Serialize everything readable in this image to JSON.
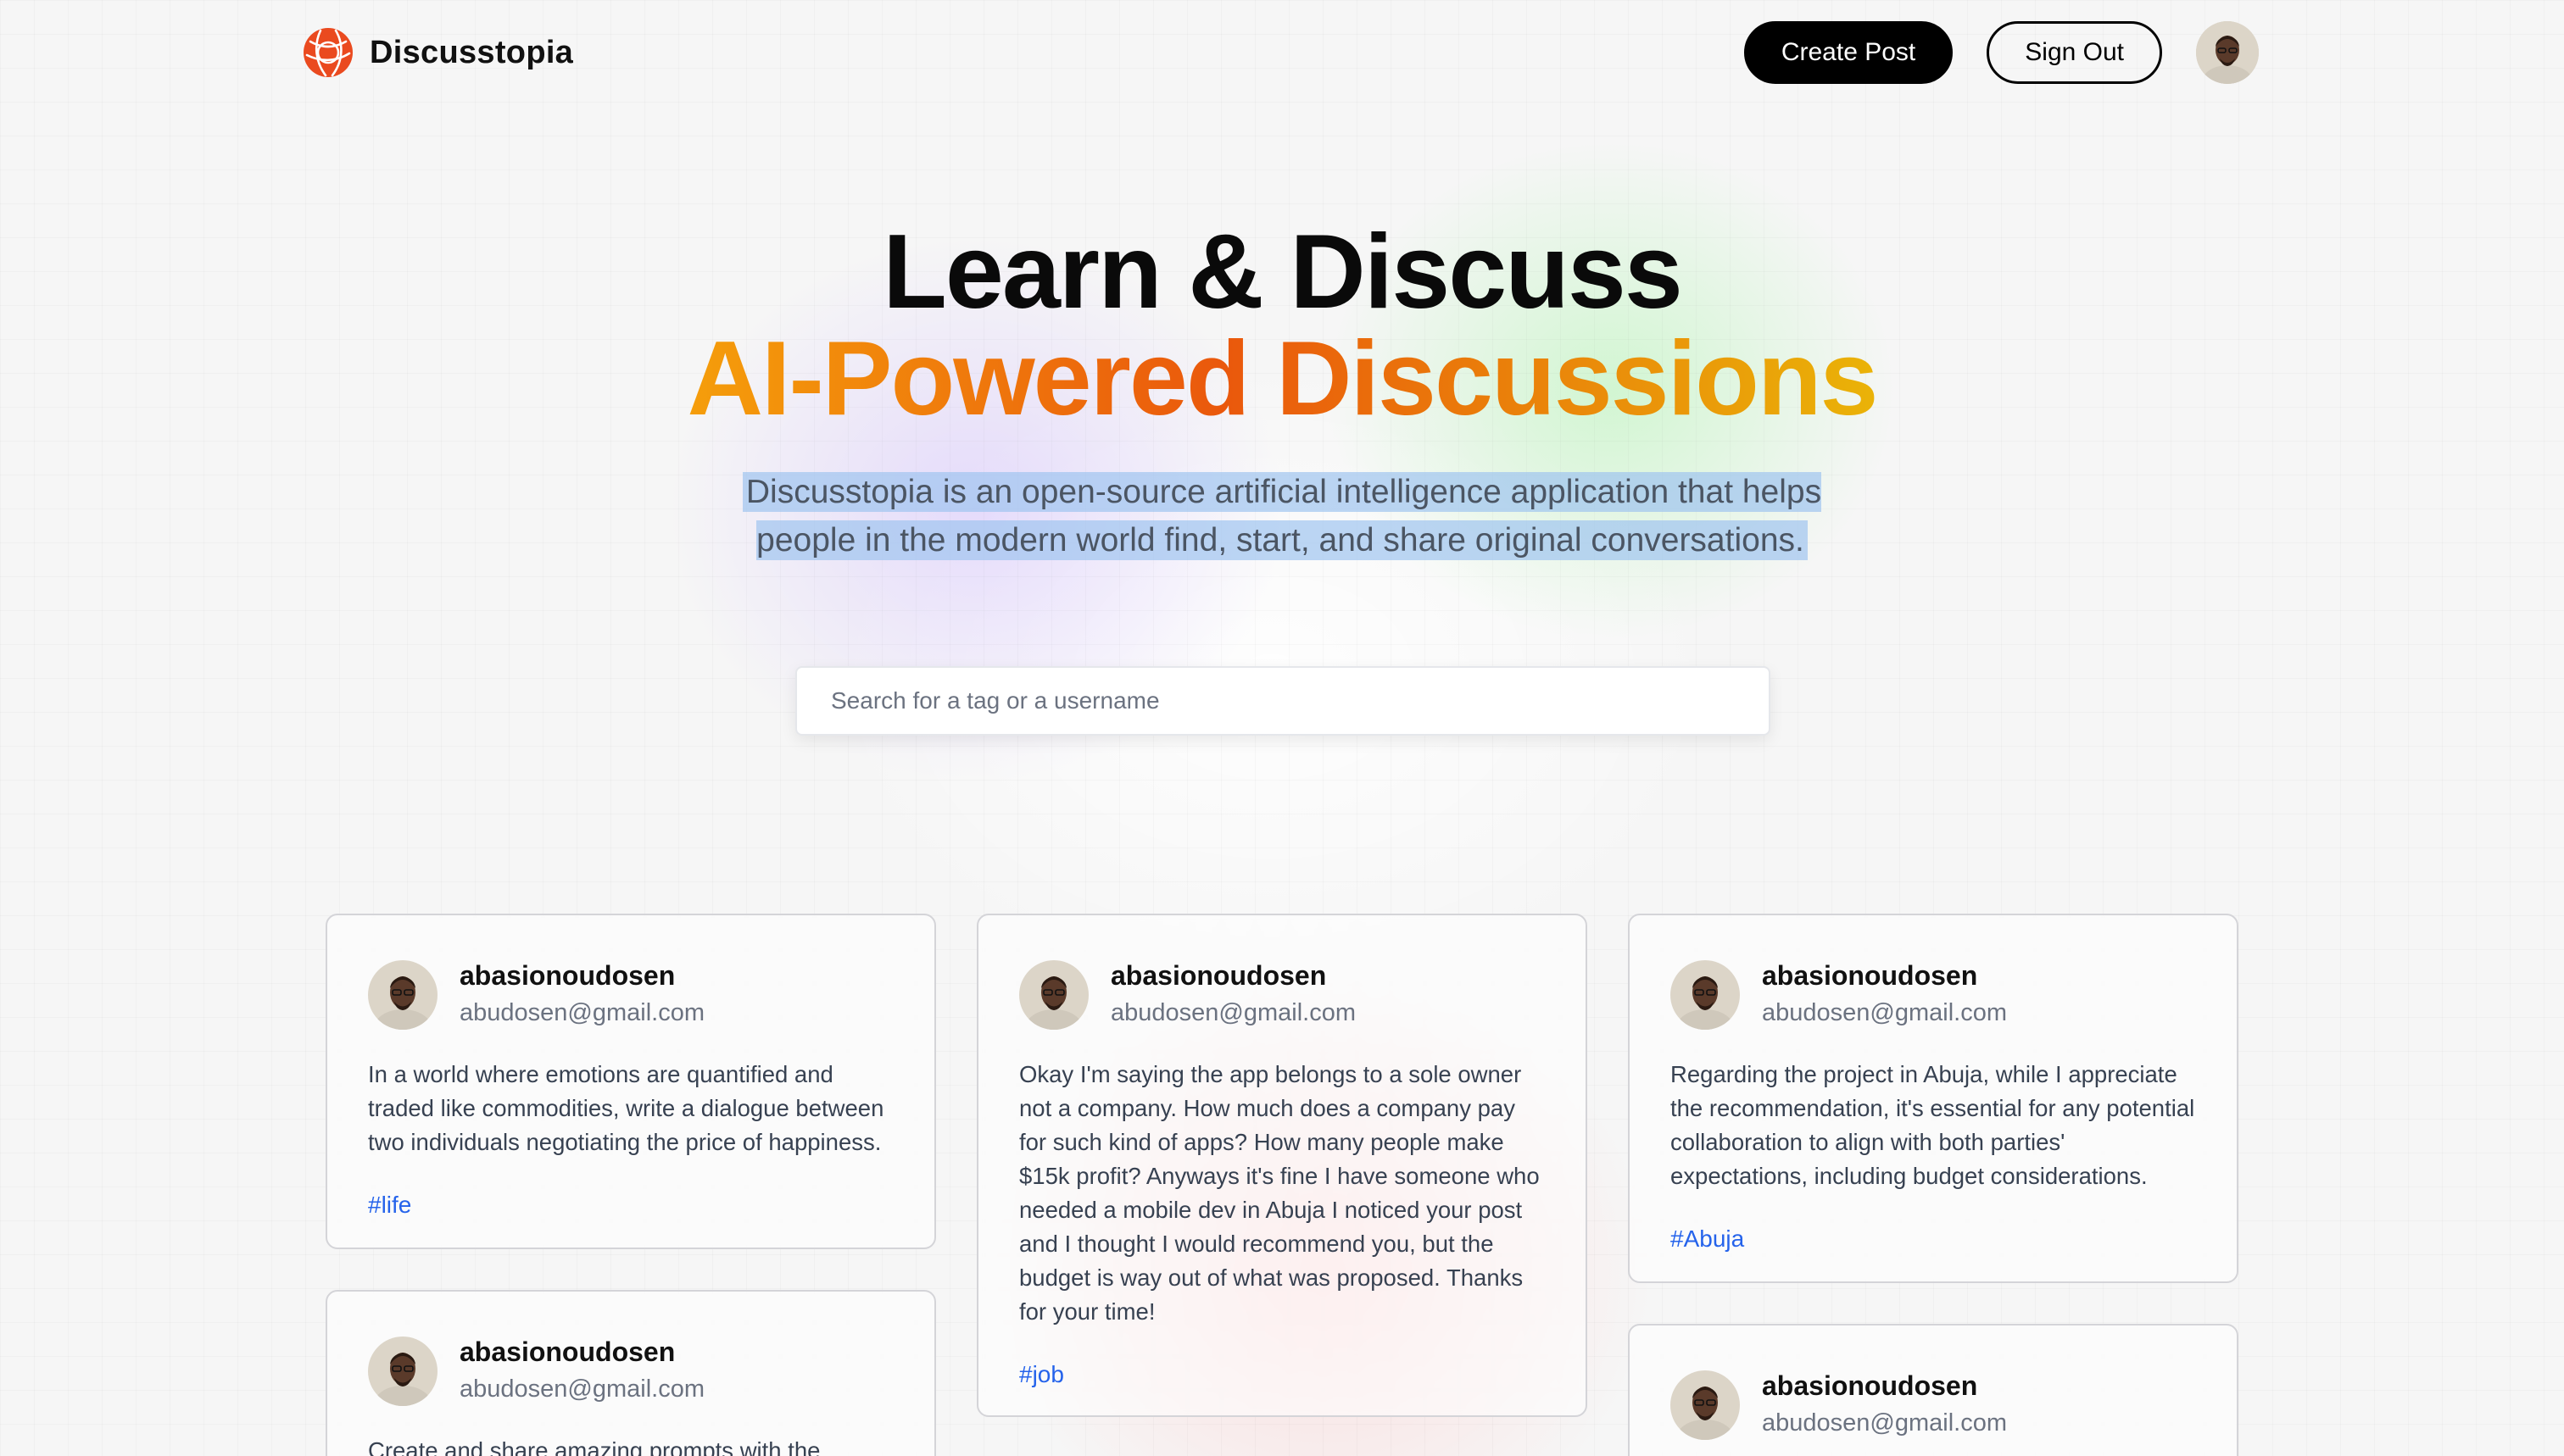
{
  "nav": {
    "brand": "Discusstopia",
    "create_post": "Create Post",
    "sign_out": "Sign Out"
  },
  "hero": {
    "title_line1": "Learn & Discuss",
    "title_line2": "AI-Powered Discussions",
    "description": "Discusstopia is an open-source artificial intelligence application that helps people in the modern world find, start, and share original conversations."
  },
  "search": {
    "placeholder": "Search for a tag or a username"
  },
  "posts": [
    {
      "username": "abasionoudosen",
      "email": "abudosen@gmail.com",
      "body": "In a world where emotions are quantified and traded like commodities, write a dialogue between two individuals negotiating the price of happiness.",
      "tag": "#life"
    },
    {
      "username": "abasionoudosen",
      "email": "abudosen@gmail.com",
      "body": "Okay I'm saying the app belongs to a sole owner not a company. How much does a company pay for such kind of apps? How many people make $15k profit? Anyways it's fine I have someone who needed a mobile dev in Abuja I noticed your post and I thought I would recommend you, but the budget is way out of what was proposed. Thanks for your time!",
      "tag": "#job"
    },
    {
      "username": "abasionoudosen",
      "email": "abudosen@gmail.com",
      "body": "Regarding the project in Abuja, while I appreciate the recommendation, it's essential for any potential collaboration to align with both parties' expectations, including budget considerations.",
      "tag": "#Abuja"
    },
    {
      "username": "abasionoudosen",
      "email": "abudosen@gmail.com",
      "body": "Create and share amazing prompts with the",
      "tag": ""
    },
    {
      "username": "abasionoudosen",
      "email": "abudosen@gmail.com",
      "body": "",
      "tag": ""
    }
  ],
  "colors": {
    "primary_button": "#000000",
    "gradient_start": "#f59e0b",
    "gradient_mid": "#ea580c",
    "gradient_end": "#eab308",
    "tag_link": "#2563eb",
    "logo": "#ea4a1f"
  },
  "icons": {
    "logo": "globe-logo-icon",
    "avatar": "user-avatar-photo"
  }
}
